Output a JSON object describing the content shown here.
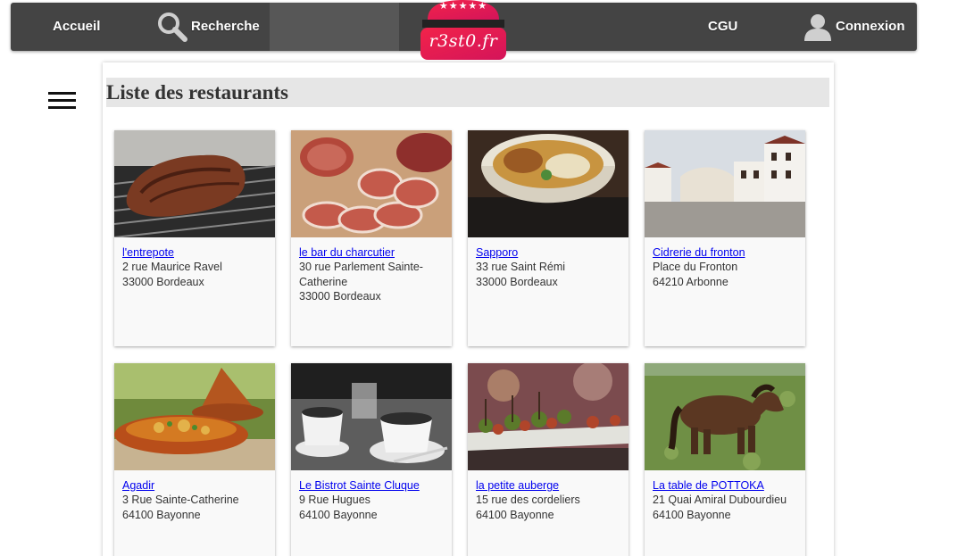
{
  "nav": {
    "home_label": "Accueil",
    "search_label": "Recherche",
    "terms_label": "CGU",
    "login_label": "Connexion"
  },
  "logo": {
    "text": "r3st0.fr",
    "stars": "★★★★★",
    "color": "#e8174f"
  },
  "page_title": "Liste des restaurants",
  "restaurants": [
    {
      "name": "l'entrepote",
      "address": "2 rue Maurice Ravel",
      "city": "33000 Bordeaux",
      "photo": "grilled-meat-photo"
    },
    {
      "name": "le bar du charcutier",
      "address": "30 rue Parlement Sainte-Catherine",
      "city": "33000 Bordeaux",
      "photo": "sliced-sausage-photo"
    },
    {
      "name": "Sapporo",
      "address": "33 rue Saint Rémi",
      "city": "33000 Bordeaux",
      "photo": "noodle-bowl-photo"
    },
    {
      "name": "Cidrerie du fronton",
      "address": "Place du Fronton",
      "city": "64210 Arbonne",
      "photo": "village-square-photo"
    },
    {
      "name": "Agadir",
      "address": "3 Rue Sainte-Catherine",
      "city": "64100 Bayonne",
      "photo": "tagine-photo"
    },
    {
      "name": "Le Bistrot Sainte Cluque",
      "address": "9 Rue Hugues",
      "city": "64100 Bayonne",
      "photo": "coffee-cups-photo"
    },
    {
      "name": "la petite auberge",
      "address": "15 rue des cordeliers",
      "city": "64100 Bayonne",
      "photo": "skewers-photo"
    },
    {
      "name": "La table de POTTOKA",
      "address": "21 Quai Amiral Dubourdieu",
      "city": "64100 Bayonne",
      "photo": "pony-photo"
    }
  ]
}
